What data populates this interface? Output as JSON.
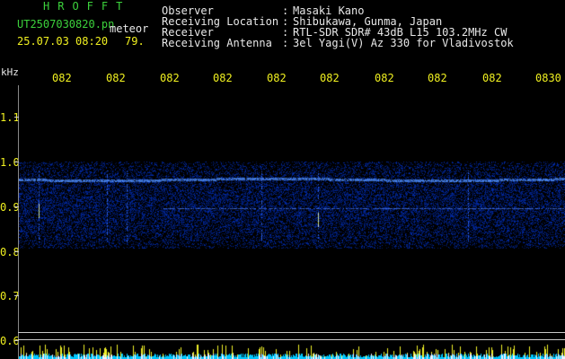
{
  "header": {
    "brand": "HROFFT",
    "filename": "UT2507030820.pn",
    "meteor_label": "meteor",
    "datetime": "25.07.03 08:20",
    "count": "79.",
    "info": [
      {
        "label": "Observer",
        "sep": ":",
        "value": "Masaki Kano"
      },
      {
        "label": "Receiving Location",
        "sep": ":",
        "value": "Shibukawa, Gunma, Japan"
      },
      {
        "label": "Receiver",
        "sep": ":",
        "value": "RTL-SDR SDR# 43dB L15 103.2MHz CW"
      },
      {
        "label": "Receiving Antenna",
        "sep": ":",
        "value": "3el Yagi(V) Az 330 for Vladivostok"
      }
    ]
  },
  "axis": {
    "unit": "kHz",
    "y_ticks": [
      "1.1",
      "1.0",
      "0.9",
      "0.8",
      "0.7",
      "0.6"
    ],
    "x_ticks": [
      "082",
      "082",
      "082",
      "082",
      "082",
      "082",
      "082",
      "082",
      "082",
      "0830"
    ]
  },
  "colors": {
    "title": "#3cd23c",
    "label": "#e8e8e8",
    "tick": "#f0f020",
    "signal": "#2a3cff",
    "meteor_trace": "#f0f020",
    "noise_floor": "#00c8ff"
  }
}
